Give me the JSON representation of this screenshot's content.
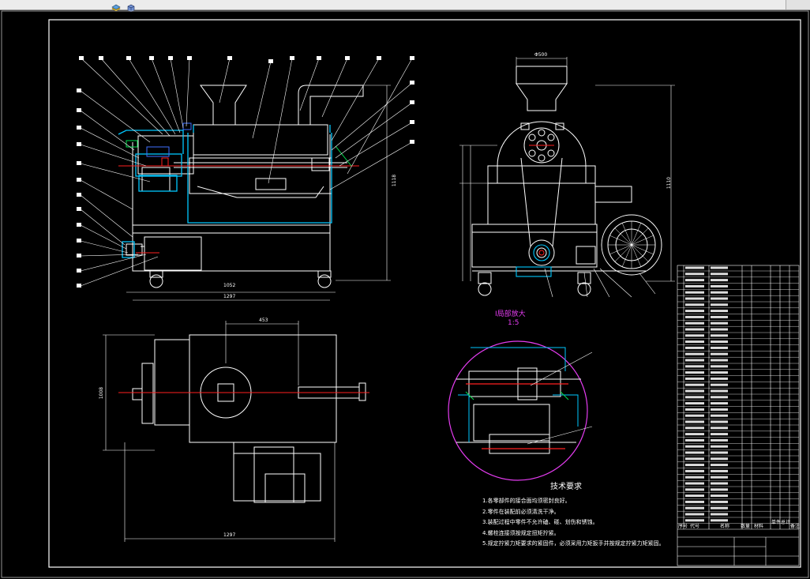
{
  "app": {
    "toolbar_icons": [
      "layer-icon",
      "cube-icon"
    ]
  },
  "drawing": {
    "background": "#000000",
    "line_color": "#ffffff",
    "section_color": "#00c8ff",
    "centerline_color": "#ff2020",
    "detail_circle_color": "#e43cf0",
    "dimensions": {
      "side_width": "1297",
      "side_inner_width": "1052",
      "side_height": "1118",
      "plan_top": "453",
      "plan_length": "1297",
      "plan_width": "1008",
      "end_top": "Φ500",
      "end_height": "1110"
    },
    "detail_view": {
      "label": "I局部放大",
      "scale": "1:5"
    },
    "tech_requirements": {
      "title": "技术要求",
      "items": [
        "1.各零部件的接合面均须密封良好。",
        "2.零件在装配前必须清洗干净。",
        "3.装配过程中零件不允许磕、碰、划伤和锈蚀。",
        "4.螺栓连接须按规定扭矩拧紧。",
        "5.规定拧紧力矩要求的紧固件，必须采用力矩扳手并按规定拧紧力矩紧固。"
      ]
    },
    "title_block_headers": [
      "序号",
      "代号",
      "名称",
      "数量",
      "材料",
      "单件",
      "总计",
      "备注"
    ]
  }
}
